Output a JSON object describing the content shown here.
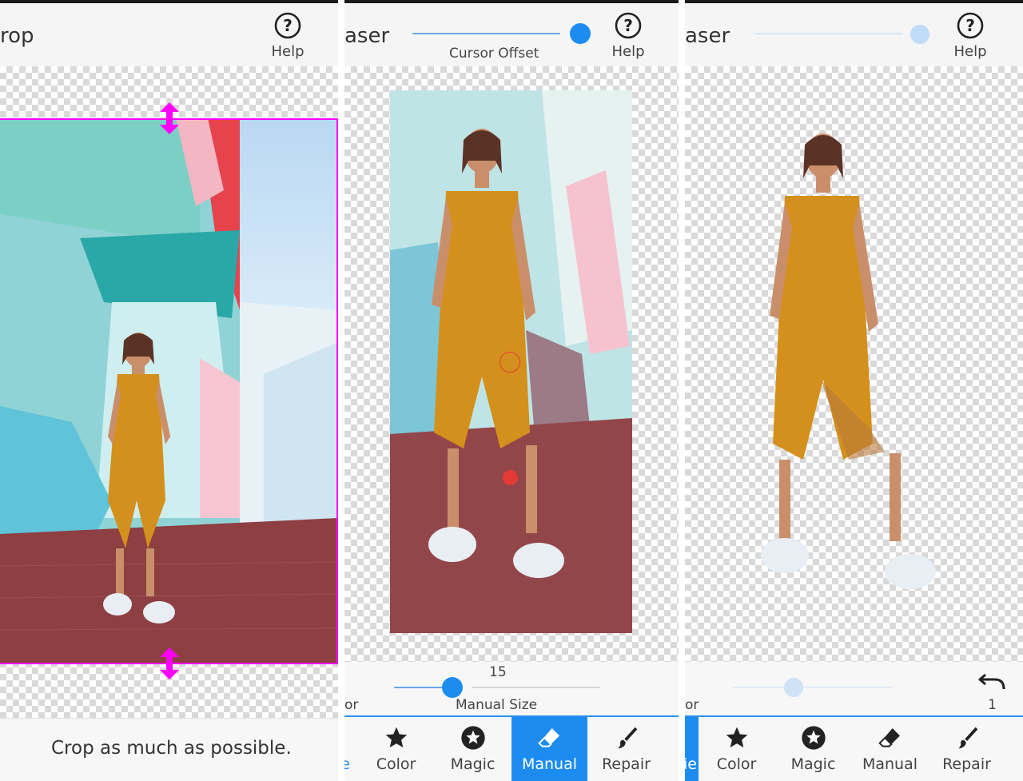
{
  "panel1": {
    "title": "rop",
    "help_label": "Help",
    "instruction": "Crop as much as possible."
  },
  "panel2": {
    "title": "aser",
    "cursor_offset_label": "Cursor Offset",
    "cursor_offset_value": 1.0,
    "help_label": "Help",
    "size_value": "15",
    "size_slider_value": 0.3,
    "manual_size_label": "Manual Size",
    "partial_left_label": "or",
    "tabs": [
      {
        "label": "ie",
        "icon": "partial-tab"
      },
      {
        "label": "Color",
        "icon": "star-icon"
      },
      {
        "label": "Magic",
        "icon": "star-circle-icon"
      },
      {
        "label": "Manual",
        "icon": "eraser-icon",
        "active": true
      },
      {
        "label": "Repair",
        "icon": "brush-icon"
      }
    ]
  },
  "panel3": {
    "title": "aser",
    "help_label": "Help",
    "undo_count": "1",
    "partial_left_label": "or",
    "tabs": [
      {
        "label": "ie",
        "icon": "partial-tab"
      },
      {
        "label": "Color",
        "icon": "star-icon"
      },
      {
        "label": "Magic",
        "icon": "star-circle-icon"
      },
      {
        "label": "Manual",
        "icon": "eraser-icon"
      },
      {
        "label": "Repair",
        "icon": "brush-icon"
      }
    ]
  },
  "colors": {
    "accent": "#1d8cf0",
    "crop_frame": "#ff00ff",
    "jumpsuit": "#d4901c",
    "marker": "#e53935"
  }
}
